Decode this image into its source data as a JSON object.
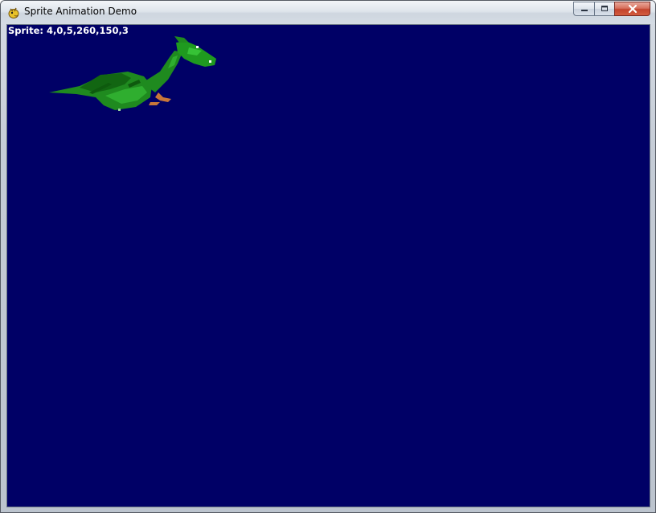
{
  "window": {
    "title": "Sprite Animation Demo",
    "icon": "pygame-snake-icon",
    "buttons": {
      "minimize": "minimize-icon",
      "maximize": "maximize-icon",
      "close": "close-icon"
    }
  },
  "canvas": {
    "background_color": "#000066",
    "sprite_label": "Sprite: 4,0,5,260,150,3",
    "sprite": "green-dragon"
  }
}
